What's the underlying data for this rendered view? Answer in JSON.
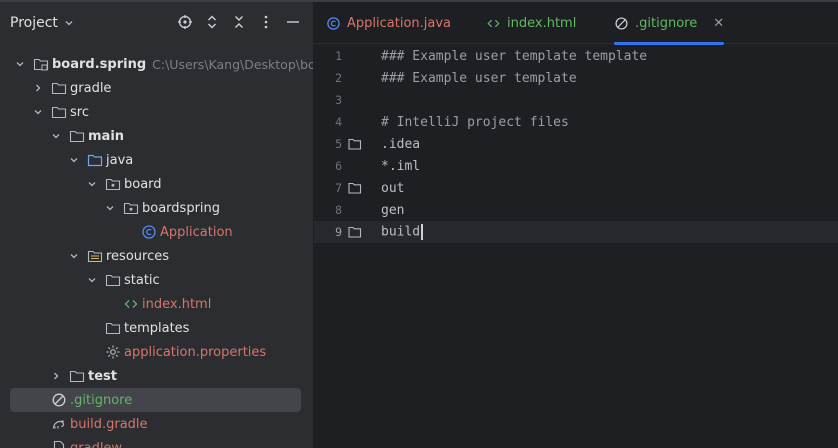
{
  "project_panel": {
    "title": "Project",
    "tree": [
      {
        "label": "board.spring",
        "path": "C:\\Users\\Kang\\Desktop\\boar",
        "bold": true,
        "icon": "module-folder-icon",
        "arrow": "down",
        "depth": 0
      },
      {
        "label": "gradle",
        "icon": "folder-icon",
        "arrow": "right",
        "depth": 1
      },
      {
        "label": "src",
        "icon": "folder-icon",
        "arrow": "down",
        "depth": 1
      },
      {
        "label": "main",
        "icon": "folder-icon",
        "arrow": "down",
        "depth": 2,
        "bold": true
      },
      {
        "label": "java",
        "icon": "source-folder-icon",
        "arrow": "down",
        "depth": 3
      },
      {
        "label": "board",
        "icon": "package-icon",
        "arrow": "down",
        "depth": 4
      },
      {
        "label": "boardspring",
        "icon": "package-icon",
        "arrow": "down",
        "depth": 5
      },
      {
        "label": "Application",
        "icon": "java-class-icon",
        "arrow": "none",
        "depth": 6,
        "color": "orange"
      },
      {
        "label": "resources",
        "icon": "resources-folder-icon",
        "arrow": "down",
        "depth": 3
      },
      {
        "label": "static",
        "icon": "folder-icon",
        "arrow": "down",
        "depth": 4
      },
      {
        "label": "index.html",
        "icon": "html-file-icon",
        "arrow": "none",
        "depth": 5,
        "color": "orange"
      },
      {
        "label": "templates",
        "icon": "folder-icon",
        "arrow": "none",
        "depth": 4
      },
      {
        "label": "application.properties",
        "icon": "properties-file-icon",
        "arrow": "none",
        "depth": 4,
        "color": "orange"
      },
      {
        "label": "test",
        "icon": "folder-icon",
        "arrow": "right",
        "depth": 2,
        "bold": true
      },
      {
        "label": ".gitignore",
        "icon": "gitignore-file-icon",
        "arrow": "none",
        "depth": 1,
        "color": "green",
        "selected": true
      },
      {
        "label": "build.gradle",
        "icon": "gradle-file-icon",
        "arrow": "none",
        "depth": 1,
        "color": "orange"
      },
      {
        "label": "gradlew",
        "icon": "file-icon",
        "arrow": "none",
        "depth": 1,
        "color": "orange"
      }
    ]
  },
  "tabs": [
    {
      "label": "Application.java",
      "icon": "java-class-icon",
      "color": "orange",
      "active": false
    },
    {
      "label": "index.html",
      "icon": "html-file-icon",
      "color": "green",
      "active": false
    },
    {
      "label": ".gitignore",
      "icon": "gitignore-file-icon",
      "color": "green",
      "active": true
    }
  ],
  "editor": {
    "lines": [
      {
        "num": "1",
        "text": "### Example user template template",
        "folder": false
      },
      {
        "num": "2",
        "text": "### Example user template",
        "folder": false
      },
      {
        "num": "3",
        "text": "",
        "folder": false
      },
      {
        "num": "4",
        "text": "# IntelliJ project files",
        "folder": false
      },
      {
        "num": "5",
        "text": ".idea",
        "folder": true
      },
      {
        "num": "6",
        "text": "*.iml",
        "folder": false
      },
      {
        "num": "7",
        "text": "out",
        "folder": true
      },
      {
        "num": "8",
        "text": "gen",
        "folder": false
      },
      {
        "num": "9",
        "text": "build",
        "folder": true,
        "current": true
      }
    ]
  },
  "colors": {
    "accent": "#3574f0",
    "modified_file": "#d7756b",
    "new_file": "#5fb865",
    "folder": "#8ab4f8"
  }
}
